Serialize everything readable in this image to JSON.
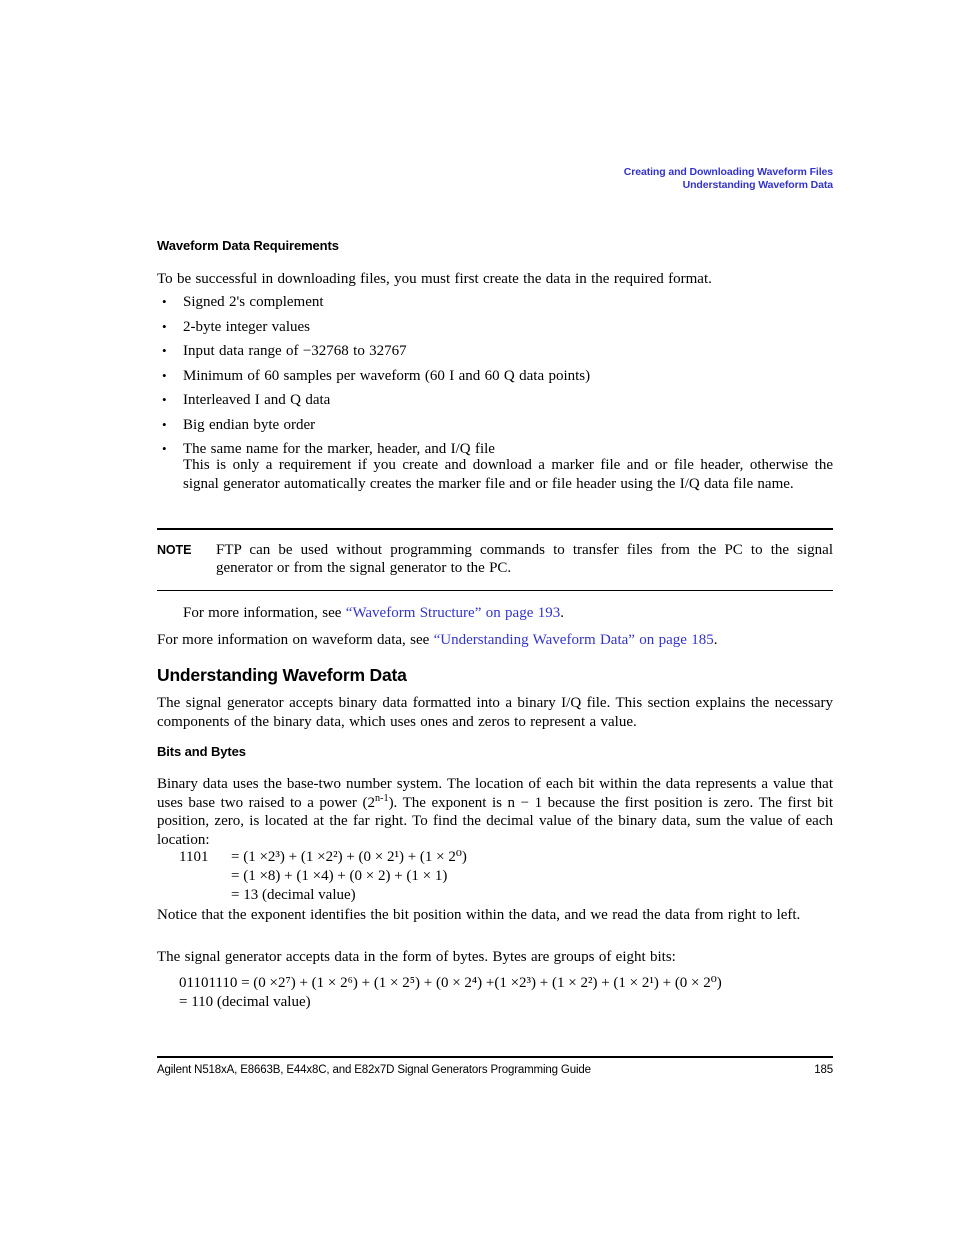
{
  "running_header": {
    "line1": "Creating and Downloading Waveform Files",
    "line2": "Understanding Waveform Data",
    "color": "#3333cc"
  },
  "sections": {
    "waveform_data_requirements": {
      "heading": "Waveform Data Requirements",
      "intro": "To be successful in downloading files, you must first create the data in the required format.",
      "bullets": [
        "Signed 2's complement",
        "2-byte integer values",
        "Input data range of −32768 to 32767",
        "Minimum of 60 samples per waveform (60 I and 60 Q data points)",
        "Interleaved I and Q data",
        "Big endian byte order",
        "The same name for the marker, header, and I/Q file"
      ],
      "bullet_note": "This is only a requirement if you create and download a marker file and or file header, otherwise the signal generator automatically creates the marker file and or file header using the I/Q data file name."
    },
    "note": {
      "label": "NOTE",
      "text": "FTP can be used without programming commands to transfer files from the PC to the signal generator or from the signal generator to the PC."
    },
    "xref_1": {
      "prefix": "For more information, see ",
      "link": "“Waveform Structure” on page 193",
      "suffix": "."
    },
    "xref_2": {
      "prefix": "For more information on waveform data, see ",
      "link": "“Understanding Waveform Data” on page 185",
      "suffix": "."
    },
    "understanding_waveform_data": {
      "heading": "Understanding Waveform Data",
      "paragraph": "The signal generator accepts binary data formatted into a binary I/Q file. This section explains the necessary components of the binary data, which uses ones and zeros to represent a value."
    },
    "bits_and_bytes": {
      "heading": "Bits and Bytes",
      "paragraph_1_part1": "Binary data uses the base-two number system. The location of each bit within the data represents a value that uses base two raised to a power (2",
      "paragraph_1_sup": "n-1",
      "paragraph_1_part2": "). The exponent is n − 1 because the first position is zero. The first bit position, zero, is located at the far right. To find the decimal value of the binary data, sum the value of each location:",
      "equation_1": {
        "line1_lhs": "1101",
        "line1_rhs": "= (1 ×2³) + (1 ×2²) + (0 × 2¹) + (1 × 2⁰)",
        "line2_rhs": "= (1 ×8) + (1 ×4) + (0 × 2) + (1 × 1)",
        "line3_rhs": "= 13 (decimal value)"
      },
      "paragraph_2": "Notice that the exponent identifies the bit position within the data, and we read the data from right to left.",
      "paragraph_3": "The signal generator accepts data in the form of bytes. Bytes are groups of eight bits:",
      "equation_2": {
        "line1": "01101110 = (0 ×2⁷) + (1 × 2⁶) + (1 × 2⁵) + (0 × 2⁴) +(1 ×2³) + (1 × 2²) + (1 × 2¹) + (0 × 2⁰)",
        "line2": "= 110 (decimal value)"
      }
    }
  },
  "footer": {
    "left": "Agilent N518xA, E8663B, E44x8C, and E82x7D Signal Generators Programming Guide",
    "page_number": "185"
  }
}
